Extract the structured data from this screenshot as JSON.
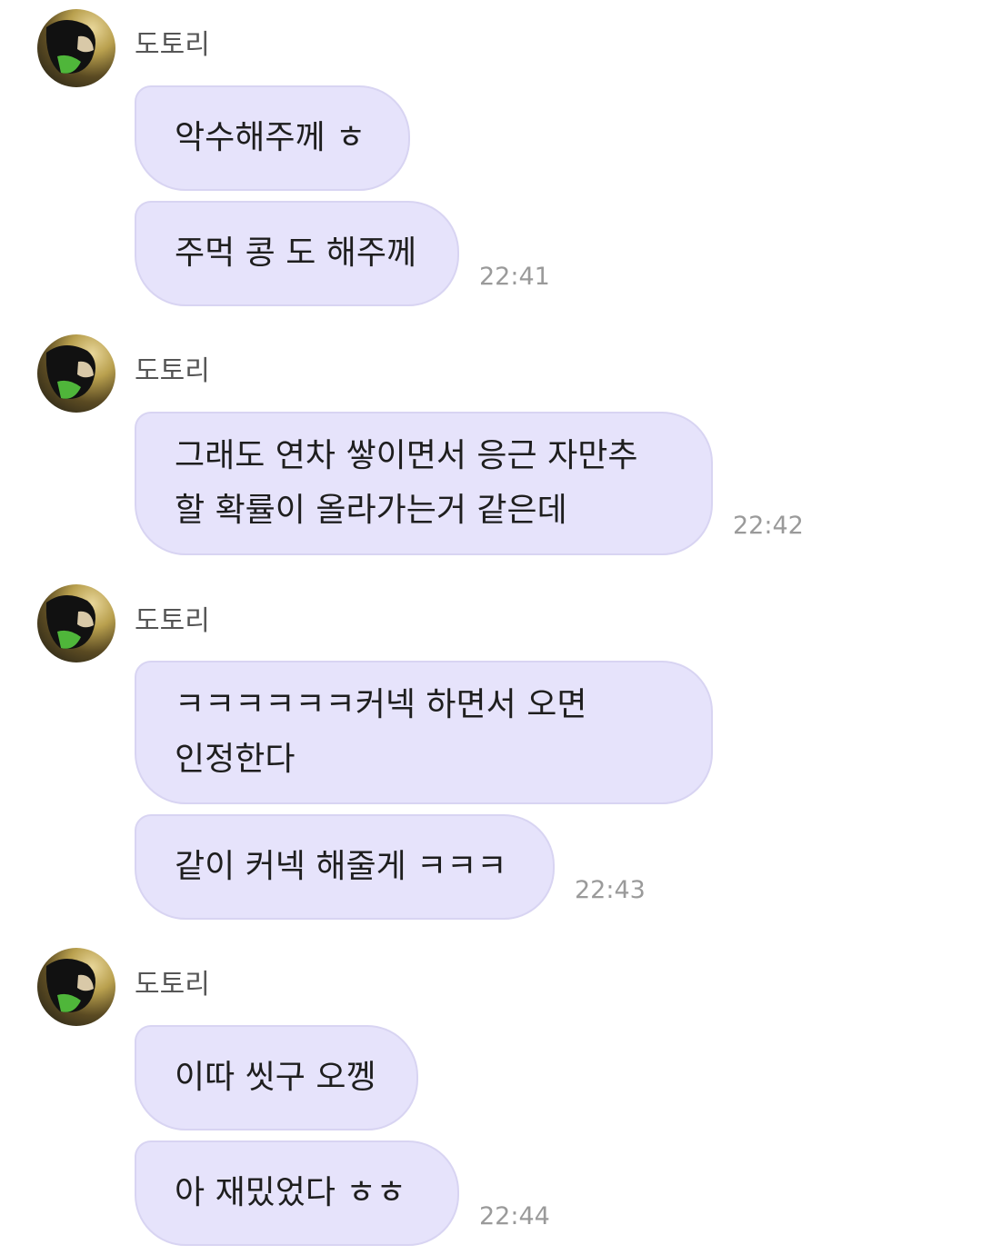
{
  "messages": [
    {
      "sender": "도토리",
      "bubbles": [
        "악수해주께 ㅎ",
        "주먹 콩 도 해주께"
      ],
      "time": "22:41"
    },
    {
      "sender": "도토리",
      "bubbles": [
        "그래도 연차 쌓이면서 응근 자만추\n할 확률이 올라가는거 같은데"
      ],
      "time": "22:42"
    },
    {
      "sender": "도토리",
      "bubbles": [
        "ㅋㅋㅋㅋㅋㅋ커넥 하면서 오면\n인정한다",
        "같이 커넥 해줄게 ㅋㅋㅋ"
      ],
      "time": "22:43"
    },
    {
      "sender": "도토리",
      "bubbles": [
        "이따 씻구 오껭",
        "아 재밌었다 ㅎㅎ"
      ],
      "time": "22:44"
    }
  ],
  "colors": {
    "bubble_bg": "#e6e3fb",
    "bubble_border": "#d8d4f2",
    "name_text": "#555555",
    "time_text": "#9a9a9a"
  },
  "icons": {
    "avatar": "profile-photo-avatar"
  }
}
